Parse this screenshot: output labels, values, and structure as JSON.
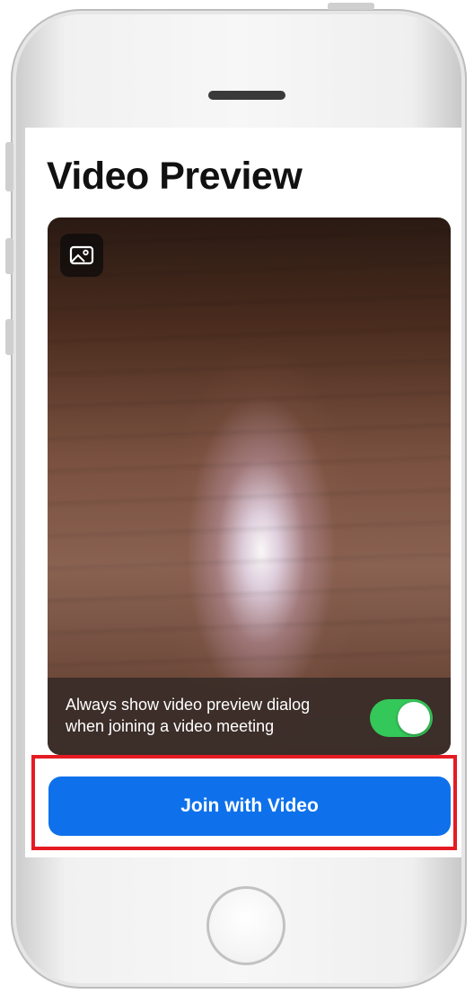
{
  "header": {
    "title": "Video Preview"
  },
  "preview": {
    "background_button_icon": "image-background-icon",
    "always_show_label": "Always show video preview dialog when joining a video meeting",
    "always_show_enabled": true
  },
  "actions": {
    "join_video_label": "Join with Video"
  },
  "colors": {
    "accent": "#0e71eb",
    "toggle_on": "#34c759",
    "highlight": "#e51b23"
  }
}
